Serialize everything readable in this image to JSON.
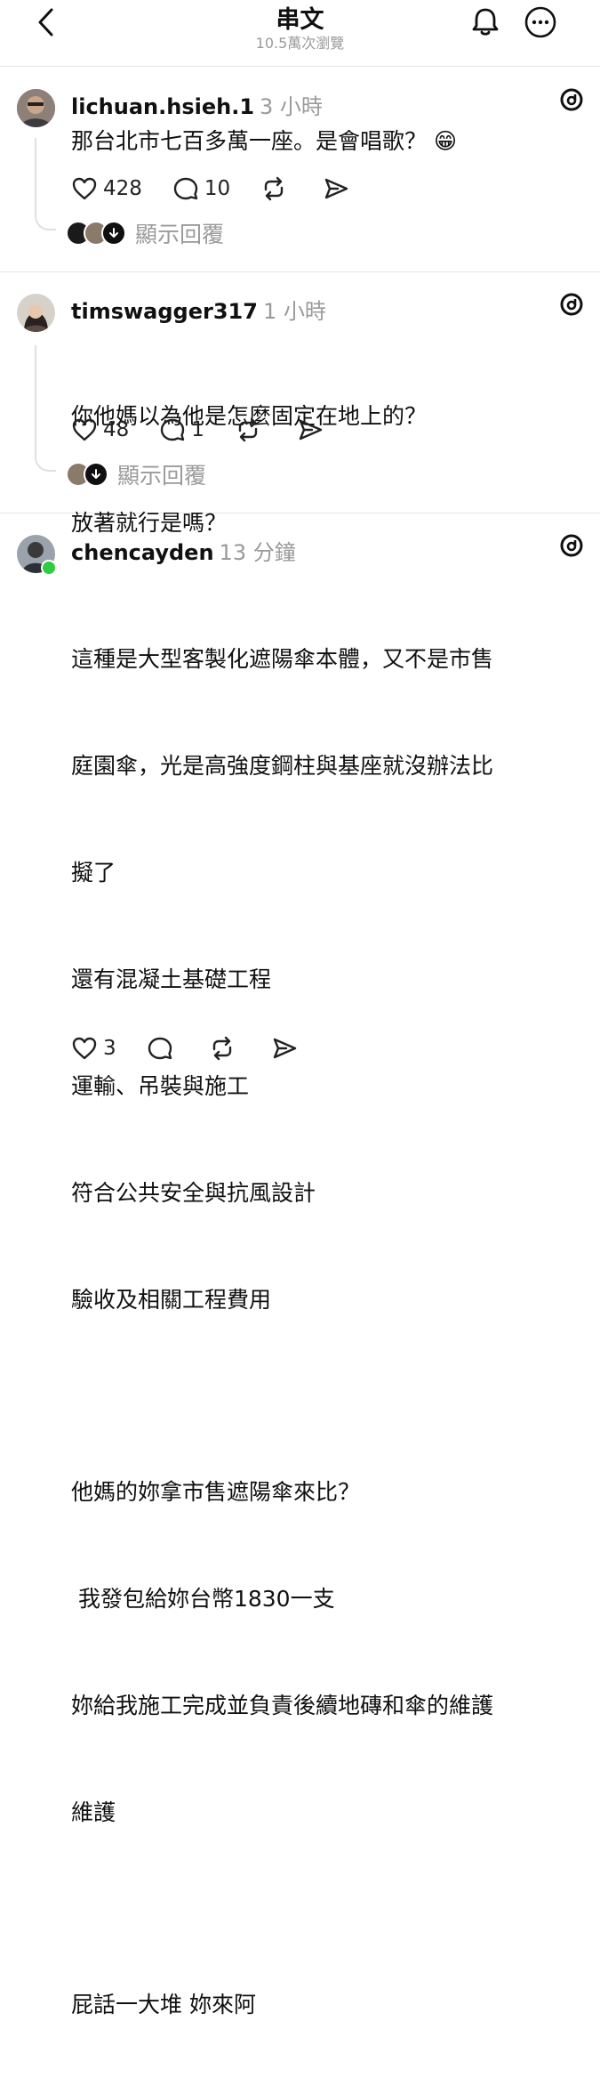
{
  "header": {
    "title": "串文",
    "views": "10.5萬次瀏覽"
  },
  "comments": [
    {
      "username": "lichuan.hsieh.1",
      "time": "3 小時",
      "body": "那台北市七百多萬一座。是會唱歌？ 😁",
      "likes": "428",
      "replies": "10",
      "show_replies": "顯示回覆"
    },
    {
      "username": "timswagger317",
      "time": "1 小時",
      "body_lines": [
        "你他媽以為他是怎麼固定在地上的？",
        "放著就行是嗎？"
      ],
      "likes": "48",
      "replies": "1",
      "show_replies": "顯示回覆"
    },
    {
      "username": "chencayden",
      "time": "13 分鐘",
      "paragraph1": [
        "這種是大型客製化遮陽傘本體，又不是市售",
        "庭園傘，光是高強度鋼柱與基座就沒辦法比",
        "擬了",
        "還有混凝土基礎工程",
        "運輸、吊裝與施工",
        "符合公共安全與抗風設計",
        "驗收及相關工程費用"
      ],
      "paragraph2": [
        "他媽的妳拿市售遮陽傘來比？",
        " 我發包給妳台幣1830一支",
        "妳給我施工完成並負責後續地磚和傘的維護",
        "維護"
      ],
      "paragraph3": [
        "屁話一大堆 妳來阿"
      ],
      "likes": "3"
    }
  ],
  "colors": {
    "text": "#101010",
    "muted": "#9a9a9a",
    "divider": "#e6e6e6",
    "online": "#2ecc40"
  }
}
